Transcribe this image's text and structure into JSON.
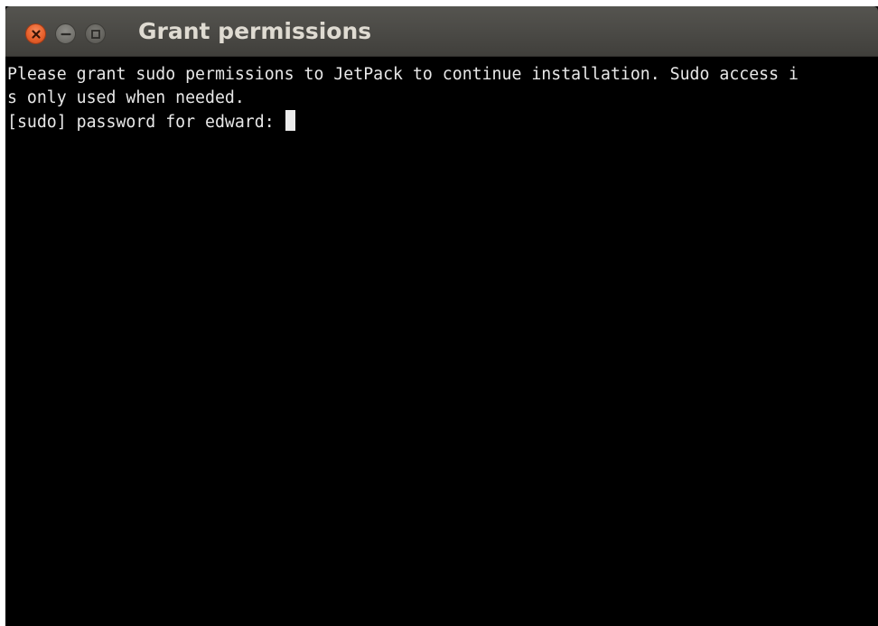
{
  "window": {
    "title": "Grant permissions",
    "controls": {
      "close_icon": "close-icon",
      "minimize_icon": "minimize-icon",
      "maximize_icon": "maximize-icon"
    },
    "colors": {
      "titlebar": "#4a4945",
      "close_button": "#e8612c",
      "title_text": "#dfdbd2",
      "terminal_bg": "#000000",
      "terminal_fg": "#e8e8e8"
    }
  },
  "terminal": {
    "lines": [
      "Please grant sudo permissions to JetPack to continue installation. Sudo access i",
      "s only used when needed.",
      "[sudo] password for edward: "
    ],
    "cursor": "block-cursor"
  }
}
